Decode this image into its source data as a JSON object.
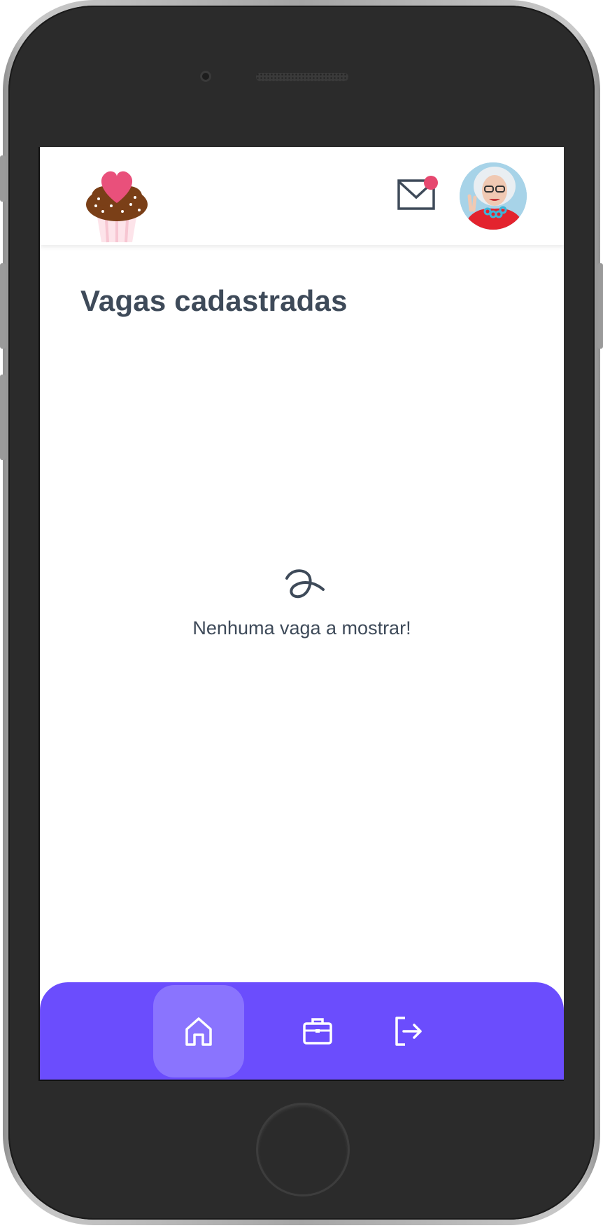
{
  "page": {
    "title": "Vagas cadastradas",
    "empty_message": "Nenhuma vaga a mostrar!"
  },
  "header": {
    "logo_icon": "cupcake-heart-logo",
    "mail_icon": "mail-icon",
    "has_notification": true,
    "avatar": "user-avatar"
  },
  "bottom_nav": {
    "items": [
      {
        "name": "home",
        "icon": "home-icon",
        "active": true
      },
      {
        "name": "jobs",
        "icon": "briefcase-icon",
        "active": false
      },
      {
        "name": "logout",
        "icon": "logout-icon",
        "active": false
      }
    ]
  },
  "colors": {
    "accent": "#6b4dfd",
    "accent_active": "#8a74fe",
    "text": "#3e4a59",
    "notification": "#e6486f"
  }
}
